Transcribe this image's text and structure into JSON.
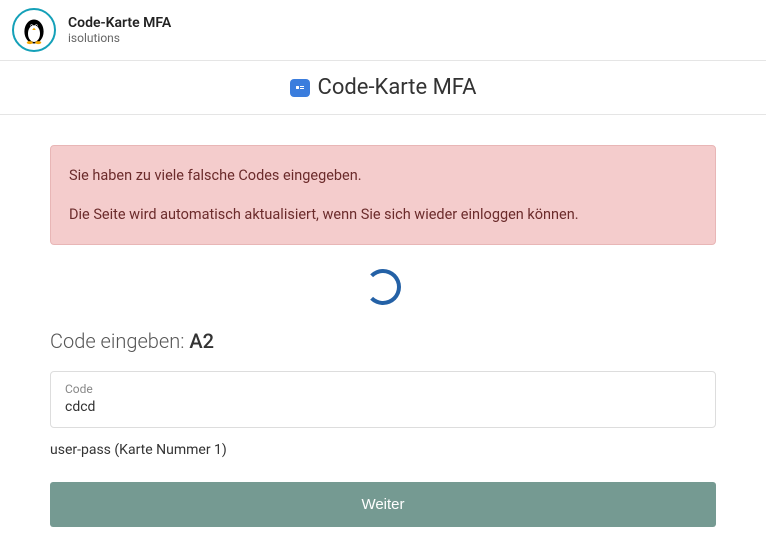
{
  "header": {
    "app_name": "Code-Karte MFA",
    "org_name": "isolutions"
  },
  "title": {
    "text": "Code-Karte MFA"
  },
  "alert": {
    "line1": "Sie haben zu viele falsche Codes eingegeben.",
    "line2": "Die Seite wird automatisch aktualisiert, wenn Sie sich wieder einloggen können."
  },
  "prompt": {
    "label": "Code eingeben: ",
    "cell": "A2"
  },
  "input": {
    "floating_label": "Code",
    "value": "cdcd"
  },
  "card_info": "user-pass (Karte Nummer 1)",
  "submit_label": "Weiter"
}
